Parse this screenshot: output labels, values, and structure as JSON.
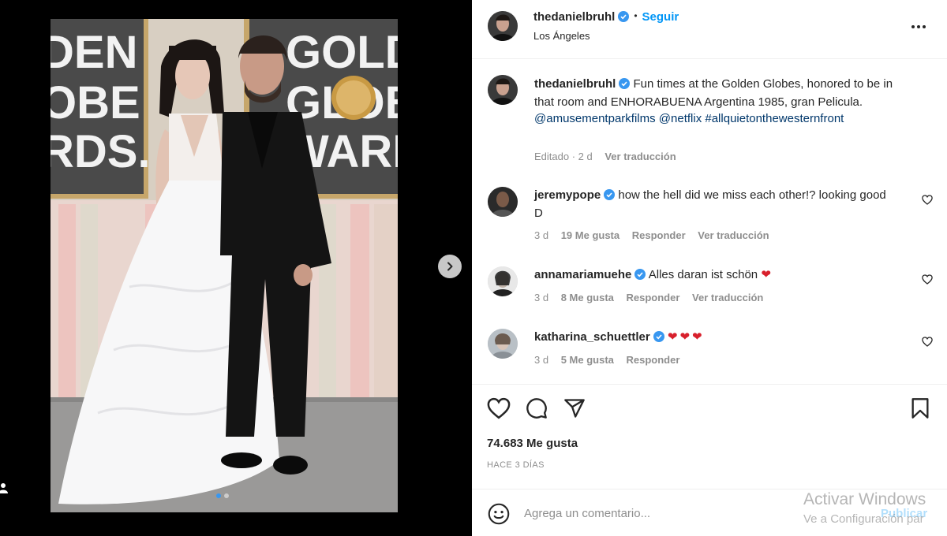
{
  "post": {
    "username": "thedanielbruhl",
    "follow_label": "Seguir",
    "bullet": "•",
    "location": "Los Ángeles",
    "caption_text": "Fun times at the Golden Globes, honored to be in that room and ENHORABUENA Argentina 1985, gran Pelicula.",
    "mention_1": "@amusementparkfilms",
    "mention_2": "@netflix",
    "hashtag": "#allquietonthewesternfront",
    "caption_meta_edited": "Editado · 2 d",
    "caption_meta_translate": "Ver traducción",
    "likes": "74.683 Me gusta",
    "date": "HACE 3 DÍAS",
    "comment_placeholder": "Agrega un comentario...",
    "publish_label": "Publicar"
  },
  "media": {
    "backdrop_text_left": [
      "DEN",
      "OBE",
      "RDS."
    ],
    "backdrop_text_right": [
      "GOLDE",
      "GLOB",
      "WARD"
    ],
    "slide_count": 2,
    "active_slide": 1
  },
  "comments": [
    {
      "username": "jeremypope",
      "text": "how the hell did we miss each other!? looking good D",
      "time": "3 d",
      "likes": "19 Me gusta",
      "reply": "Responder",
      "translate": "Ver traducción"
    },
    {
      "username": "annamariamuehe",
      "text": "Alles daran ist schön",
      "emoji": "❤",
      "time": "3 d",
      "likes": "8 Me gusta",
      "reply": "Responder",
      "translate": "Ver traducción"
    },
    {
      "username": "katharina_schuettler",
      "emoji": "❤❤❤",
      "time": "3 d",
      "likes": "5 Me gusta",
      "reply": "Responder"
    }
  ],
  "os_watermark": {
    "line1": "Activar Windows",
    "line2": "Ve a Configuración par"
  },
  "colors": {
    "accent": "#0095f6",
    "verified": "#3897f0",
    "link": "#00376b",
    "meta_gray": "#8e8e8e",
    "heart_red": "#ed4956"
  },
  "icons": [
    "chevron-right-icon",
    "verified-icon",
    "more-icon",
    "heart-icon",
    "comment-icon",
    "share-icon",
    "bookmark-icon",
    "emoji-icon",
    "user-icon"
  ]
}
